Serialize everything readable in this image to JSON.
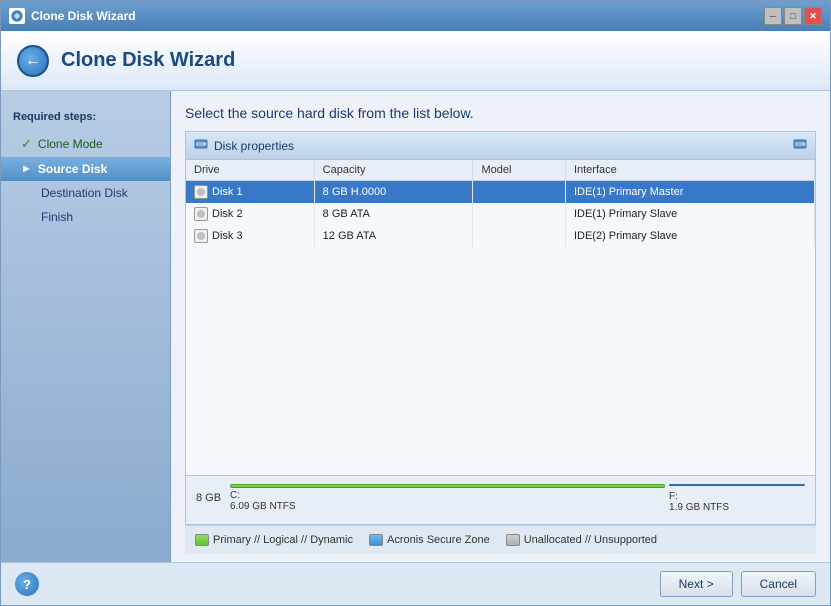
{
  "window": {
    "title": "Clone Disk Wizard",
    "controls": [
      "minimize",
      "maximize",
      "close"
    ]
  },
  "header": {
    "title": "Clone Disk Wizard"
  },
  "sidebar": {
    "section_title": "Required steps:",
    "items": [
      {
        "id": "clone-mode",
        "label": "Clone Mode",
        "state": "completed"
      },
      {
        "id": "source-disk",
        "label": "Source Disk",
        "state": "active"
      },
      {
        "id": "destination-disk",
        "label": "Destination Disk",
        "state": "normal"
      },
      {
        "id": "finish",
        "label": "Finish",
        "state": "normal"
      }
    ]
  },
  "main": {
    "instruction": "Select the source hard disk from the list below.",
    "disk_properties_title": "Disk properties",
    "table": {
      "columns": [
        "Drive",
        "Capacity",
        "Model",
        "Interface"
      ],
      "rows": [
        {
          "id": "disk1",
          "drive": "Disk 1",
          "capacity": "8 GB H.0000",
          "model": "",
          "interface": "IDE(1) Primary Master",
          "selected": true
        },
        {
          "id": "disk2",
          "drive": "Disk 2",
          "capacity": "8 GB ATA",
          "model": "",
          "interface": "IDE(1) Primary Slave",
          "selected": false
        },
        {
          "id": "disk3",
          "drive": "Disk 3",
          "capacity": "12 GB ATA",
          "model": "",
          "interface": "IDE(2) Primary Slave",
          "selected": false
        }
      ]
    }
  },
  "partition_viz": {
    "disk_size": "8 GB",
    "partitions": [
      {
        "id": "c-drive",
        "label": "C:",
        "sub_label": "6.09 GB  NTFS",
        "type": "green",
        "width_pct": 75
      },
      {
        "id": "f-drive",
        "label": "F:",
        "sub_label": "1.9 GB  NTFS",
        "type": "blue",
        "width_pct": 22
      }
    ]
  },
  "legend": {
    "items": [
      {
        "id": "primary",
        "color": "green",
        "label": "Primary // Logical // Dynamic"
      },
      {
        "id": "acronis",
        "color": "blue",
        "label": "Acronis Secure Zone"
      },
      {
        "id": "unallocated",
        "color": "gray",
        "label": "Unallocated // Unsupported"
      }
    ]
  },
  "footer": {
    "next_label": "Next >",
    "cancel_label": "Cancel"
  }
}
